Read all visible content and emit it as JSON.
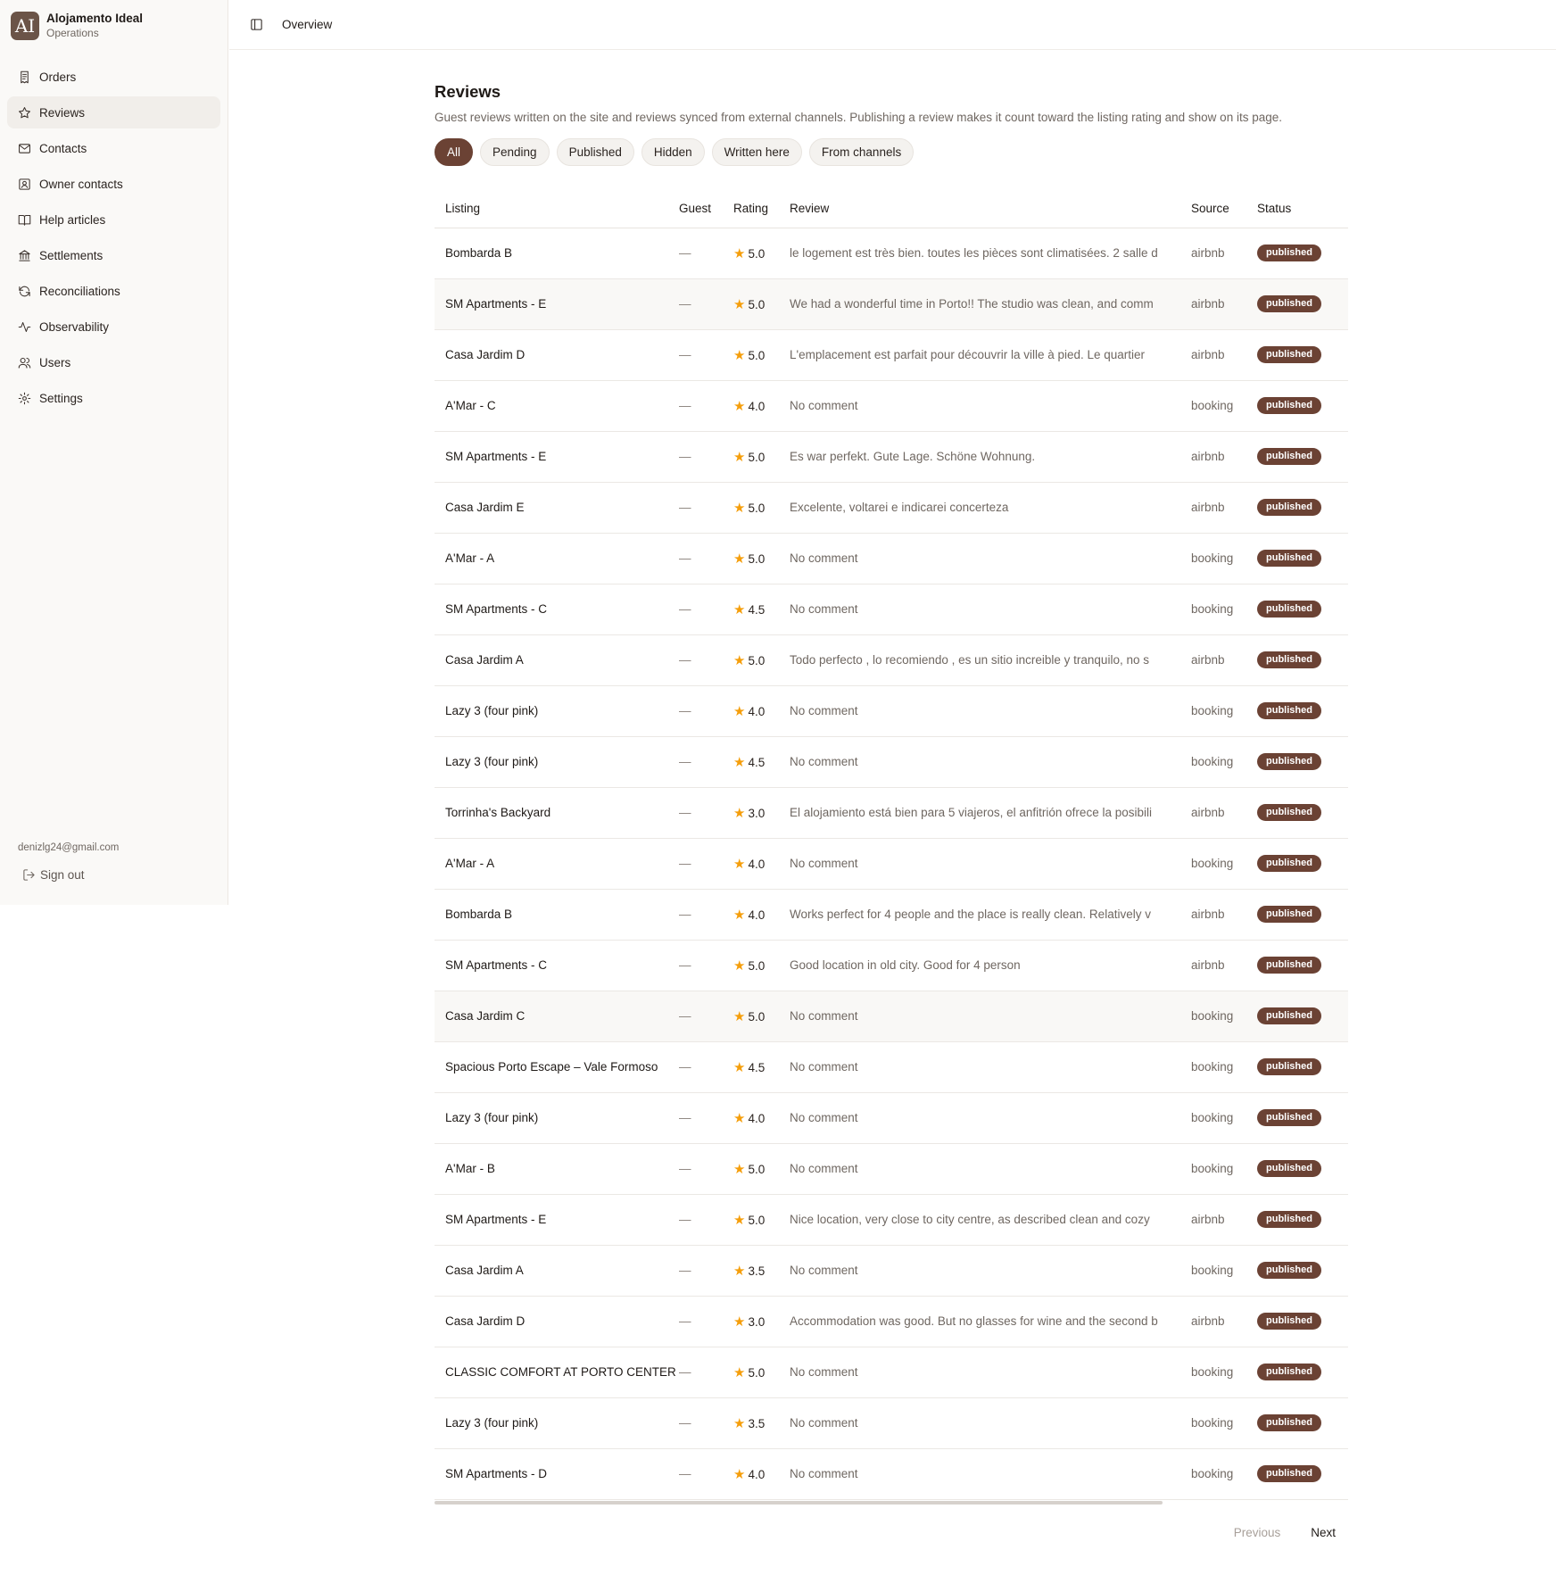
{
  "brand": {
    "logo_text": "AI",
    "name": "Alojamento Ideal",
    "subtitle": "Operations"
  },
  "nav": [
    {
      "label": "Orders",
      "icon": "receipt-icon"
    },
    {
      "label": "Reviews",
      "icon": "star-icon",
      "active": true
    },
    {
      "label": "Contacts",
      "icon": "mail-icon"
    },
    {
      "label": "Owner contacts",
      "icon": "contact-card-icon"
    },
    {
      "label": "Help articles",
      "icon": "book-icon"
    },
    {
      "label": "Settlements",
      "icon": "bank-icon"
    },
    {
      "label": "Reconciliations",
      "icon": "refresh-icon"
    },
    {
      "label": "Observability",
      "icon": "activity-icon"
    },
    {
      "label": "Users",
      "icon": "users-icon"
    },
    {
      "label": "Settings",
      "icon": "gear-icon"
    }
  ],
  "user": {
    "email": "denizlg24@gmail.com",
    "signout_label": "Sign out"
  },
  "topbar": {
    "breadcrumb": "Overview"
  },
  "page": {
    "title": "Reviews",
    "description": "Guest reviews written on the site and reviews synced from external channels. Publishing a review makes it count toward the listing rating and show on its page."
  },
  "filters": [
    {
      "label": "All",
      "active": true
    },
    {
      "label": "Pending"
    },
    {
      "label": "Published"
    },
    {
      "label": "Hidden"
    },
    {
      "label": "Written here"
    },
    {
      "label": "From channels"
    }
  ],
  "table": {
    "columns": [
      "Listing",
      "Guest",
      "Rating",
      "Review",
      "Source",
      "Status"
    ],
    "rows": [
      {
        "listing": "Bombarda B",
        "guest": "—",
        "rating": "5.0",
        "review": "le logement est très bien. toutes les pièces sont climatisées. 2 salle d",
        "source": "airbnb",
        "status": "published"
      },
      {
        "listing": "SM Apartments - E",
        "guest": "—",
        "rating": "5.0",
        "review": "We had a wonderful time in Porto!! The studio was clean, and comm",
        "source": "airbnb",
        "status": "published",
        "highlight": true
      },
      {
        "listing": "Casa Jardim D",
        "guest": "—",
        "rating": "5.0",
        "review": "L'emplacement est parfait pour découvrir la ville à pied. Le quartier",
        "source": "airbnb",
        "status": "published"
      },
      {
        "listing": "A'Mar - C",
        "guest": "—",
        "rating": "4.0",
        "review": "No comment",
        "source": "booking",
        "status": "published"
      },
      {
        "listing": "SM Apartments - E",
        "guest": "—",
        "rating": "5.0",
        "review": "Es war perfekt. Gute Lage. Schöne Wohnung.",
        "source": "airbnb",
        "status": "published"
      },
      {
        "listing": "Casa Jardim E",
        "guest": "—",
        "rating": "5.0",
        "review": "Excelente, voltarei e indicarei concerteza",
        "source": "airbnb",
        "status": "published"
      },
      {
        "listing": "A'Mar - A",
        "guest": "—",
        "rating": "5.0",
        "review": "No comment",
        "source": "booking",
        "status": "published"
      },
      {
        "listing": "SM Apartments - C",
        "guest": "—",
        "rating": "4.5",
        "review": "No comment",
        "source": "booking",
        "status": "published"
      },
      {
        "listing": "Casa Jardim A",
        "guest": "—",
        "rating": "5.0",
        "review": "Todo perfecto , lo recomiendo , es un sitio increible y tranquilo, no s",
        "source": "airbnb",
        "status": "published"
      },
      {
        "listing": "Lazy 3 (four pink)",
        "guest": "—",
        "rating": "4.0",
        "review": "No comment",
        "source": "booking",
        "status": "published"
      },
      {
        "listing": "Lazy 3 (four pink)",
        "guest": "—",
        "rating": "4.5",
        "review": "No comment",
        "source": "booking",
        "status": "published"
      },
      {
        "listing": "Torrinha's Backyard",
        "guest": "—",
        "rating": "3.0",
        "review": "El alojamiento está bien para 5 viajeros, el anfitrión ofrece la posibili",
        "source": "airbnb",
        "status": "published"
      },
      {
        "listing": "A'Mar - A",
        "guest": "—",
        "rating": "4.0",
        "review": "No comment",
        "source": "booking",
        "status": "published"
      },
      {
        "listing": "Bombarda B",
        "guest": "—",
        "rating": "4.0",
        "review": "Works perfect for 4 people and the place is really clean. Relatively v",
        "source": "airbnb",
        "status": "published"
      },
      {
        "listing": "SM Apartments - C",
        "guest": "—",
        "rating": "5.0",
        "review": "Good location in old city. Good for 4 person",
        "source": "airbnb",
        "status": "published"
      },
      {
        "listing": "Casa Jardim C",
        "guest": "—",
        "rating": "5.0",
        "review": "No comment",
        "source": "booking",
        "status": "published",
        "highlight": true
      },
      {
        "listing": "Spacious Porto Escape – Vale Formoso",
        "guest": "—",
        "rating": "4.5",
        "review": "No comment",
        "source": "booking",
        "status": "published"
      },
      {
        "listing": "Lazy 3 (four pink)",
        "guest": "—",
        "rating": "4.0",
        "review": "No comment",
        "source": "booking",
        "status": "published"
      },
      {
        "listing": "A'Mar - B",
        "guest": "—",
        "rating": "5.0",
        "review": "No comment",
        "source": "booking",
        "status": "published"
      },
      {
        "listing": "SM Apartments - E",
        "guest": "—",
        "rating": "5.0",
        "review": "Nice location, very close to city centre, as described clean and cozy",
        "source": "airbnb",
        "status": "published"
      },
      {
        "listing": "Casa Jardim A",
        "guest": "—",
        "rating": "3.5",
        "review": "No comment",
        "source": "booking",
        "status": "published"
      },
      {
        "listing": "Casa Jardim D",
        "guest": "—",
        "rating": "3.0",
        "review": "Accommodation was good. But no glasses for wine and the second b",
        "source": "airbnb",
        "status": "published"
      },
      {
        "listing": "CLASSIC COMFORT AT PORTO CENTER",
        "guest": "—",
        "rating": "5.0",
        "review": "No comment",
        "source": "booking",
        "status": "published"
      },
      {
        "listing": "Lazy 3 (four pink)",
        "guest": "—",
        "rating": "3.5",
        "review": "No comment",
        "source": "booking",
        "status": "published"
      },
      {
        "listing": "SM Apartments - D",
        "guest": "—",
        "rating": "4.0",
        "review": "No comment",
        "source": "booking",
        "status": "published"
      }
    ]
  },
  "pagination": {
    "previous_label": "Previous",
    "next_label": "Next"
  },
  "colors": {
    "accent": "#6b4234",
    "star": "#f59e0b",
    "sidebar_bg": "#faf9f7"
  }
}
